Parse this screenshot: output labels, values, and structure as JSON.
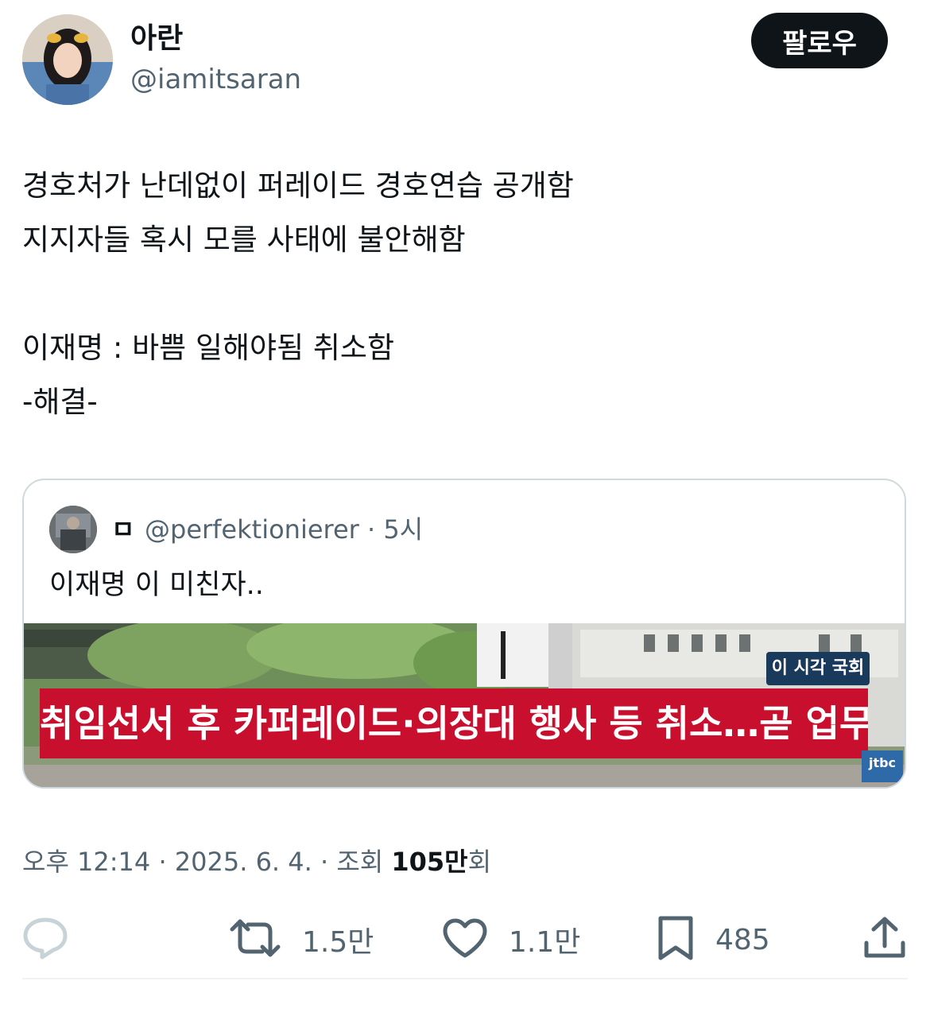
{
  "author": {
    "name": "아란",
    "handle": "@iamitsaran",
    "avatar_icon": "avatar-photo"
  },
  "follow_label": "팔로우",
  "tweet_lines": [
    "경호처가 난데없이 퍼레이드 경호연습 공개함",
    "지지자들 혹시 모를 사태에 불안해함",
    "",
    "이재명 : 바쁨 일해야됨 취소함",
    "-해결-"
  ],
  "quoted": {
    "name": "ㅁ",
    "handle": "@perfektionierer · 5시",
    "text": "이재명 이 미친자..",
    "image": {
      "badge": "이 시각 국회",
      "banner": "취임선서 후 카퍼레이드·의장대 행사 등 취소…곧 업무",
      "logo": "jtbc"
    }
  },
  "meta": {
    "time_date": "오후 12:14 · 2025. 6. 4. · 조회 ",
    "views": "105만",
    "views_suffix": "회"
  },
  "actions": {
    "reply_icon": "reply-icon",
    "retweet_count": "1.5만",
    "like_count": "1.1만",
    "bookmark_count": "485",
    "share_icon": "share-icon"
  },
  "colors": {
    "text": "#0f1419",
    "secondary": "#536471",
    "border": "#cfd9de",
    "banner_red": "#c8102e"
  }
}
